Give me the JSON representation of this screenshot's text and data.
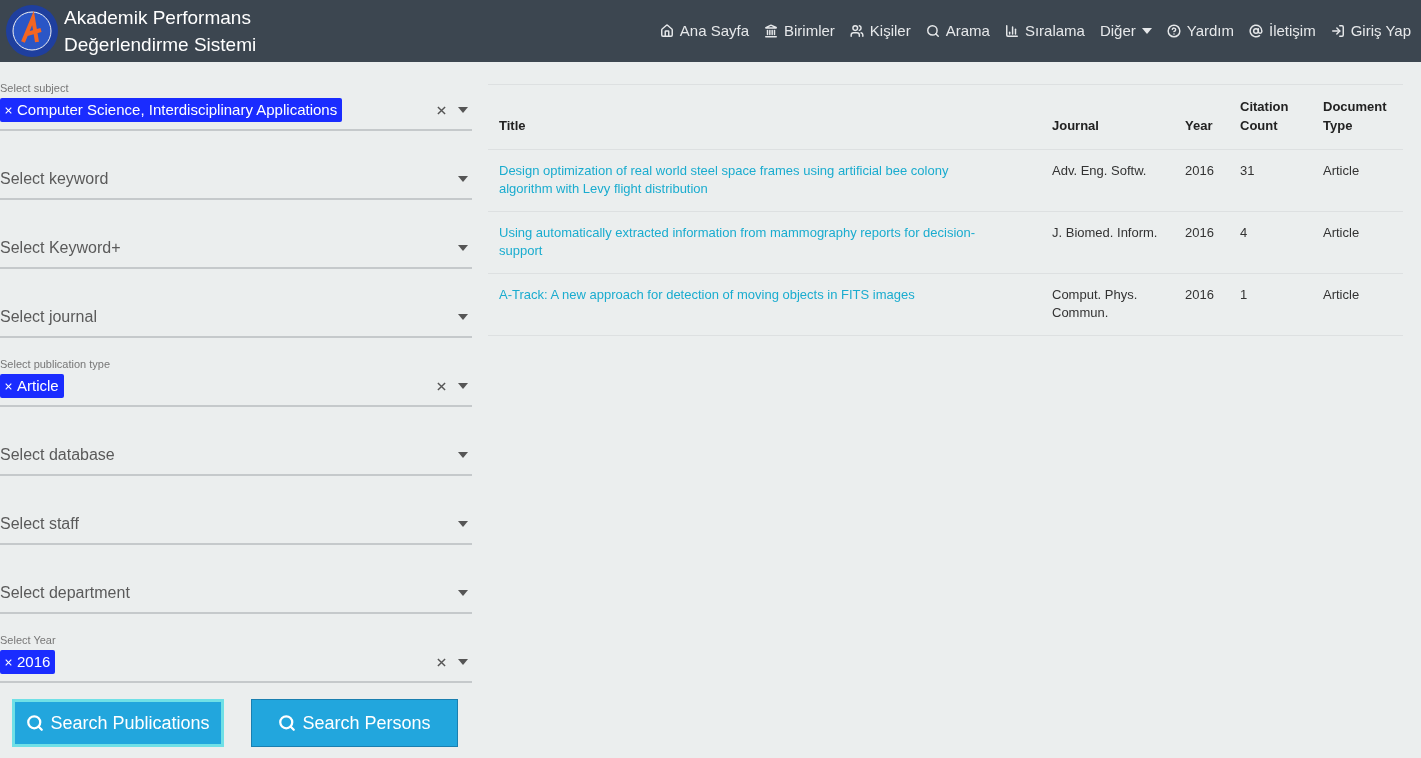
{
  "header": {
    "title_lines": [
      "Akademik Performans",
      "Değerlendirme Sistemi"
    ],
    "nav": [
      {
        "kind": "home",
        "label": "Ana Sayfa"
      },
      {
        "kind": "building",
        "label": "Birimler"
      },
      {
        "kind": "users",
        "label": "Kişiler"
      },
      {
        "kind": "search",
        "label": "Arama"
      },
      {
        "kind": "chart",
        "label": "Sıralama"
      },
      {
        "kind": "dropdown",
        "label": "Diğer"
      },
      {
        "kind": "help",
        "label": "Yardım"
      },
      {
        "kind": "at",
        "label": "İletişim"
      },
      {
        "kind": "login",
        "label": "Giriş Yap"
      }
    ]
  },
  "filters": [
    {
      "label": "Select subject",
      "chips": [
        "Computer Science, Interdisciplinary Applications"
      ]
    },
    {
      "placeholder": "Select keyword"
    },
    {
      "placeholder": "Select Keyword+"
    },
    {
      "placeholder": "Select journal"
    },
    {
      "label": "Select publication type",
      "chips": [
        "Article"
      ]
    },
    {
      "placeholder": "Select database"
    },
    {
      "placeholder": "Select staff"
    },
    {
      "placeholder": "Select department"
    },
    {
      "label": "Select Year",
      "chips": [
        "2016"
      ]
    }
  ],
  "buttons": [
    {
      "label": "Search Publications",
      "focused": true
    },
    {
      "label": "Search Persons",
      "focused": false
    }
  ],
  "table": {
    "columns": [
      "Title",
      "Journal",
      "Year",
      "Citation Count",
      "Document Type"
    ],
    "rows": [
      [
        "Design optimization of real world steel space frames using artificial bee colony algorithm with Levy flight distribution",
        "Adv. Eng. Softw.",
        "2016",
        "31",
        "Article"
      ],
      [
        "Using automatically extracted information from mammography reports for decision-support",
        "J. Biomed. Inform.",
        "2016",
        "4",
        "Article"
      ],
      [
        "A-Track: A new approach for detection of moving objects in FITS images",
        "Comput. Phys. Commun.",
        "2016",
        "1",
        "Article"
      ]
    ]
  }
}
